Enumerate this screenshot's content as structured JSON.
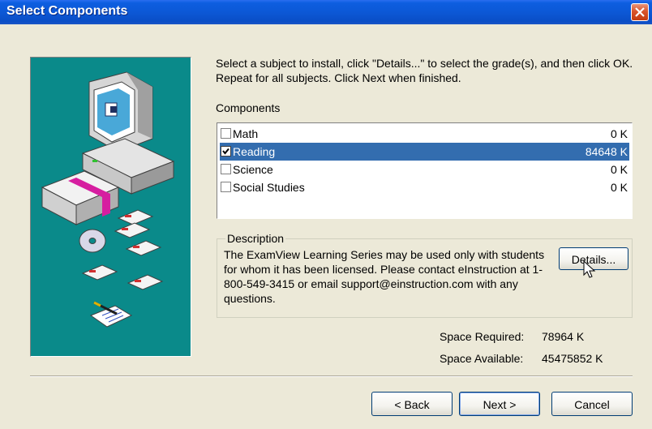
{
  "window": {
    "title": "Select Components"
  },
  "instructions": "Select a subject to install, click \"Details...\" to select the grade(s), and then click OK. Repeat for all subjects. Click Next when finished.",
  "components": {
    "label": "Components",
    "items": [
      {
        "name": "Math",
        "size": "0 K",
        "checked": false,
        "selected": false
      },
      {
        "name": "Reading",
        "size": "84648 K",
        "checked": true,
        "selected": true
      },
      {
        "name": "Science",
        "size": "0 K",
        "checked": false,
        "selected": false
      },
      {
        "name": "Social Studies",
        "size": "0 K",
        "checked": false,
        "selected": false
      }
    ]
  },
  "description": {
    "label": "Description",
    "text": "The ExamView Learning Series may be used only with students for whom it has been licensed. Please contact eInstruction at 1-800-549-3415 or email support@einstruction.com with any questions.",
    "details_label": "Details..."
  },
  "space": {
    "required_label": "Space Required:",
    "required_value": "78964 K",
    "available_label": "Space Available:",
    "available_value": "45475852 K"
  },
  "buttons": {
    "back": "< Back",
    "next": "Next >",
    "cancel": "Cancel"
  },
  "colors": {
    "titlebar": "#0c58d6",
    "selection": "#336daf",
    "dialog_bg": "#ECE9D8",
    "illustration_bg": "#0a8a8a"
  }
}
